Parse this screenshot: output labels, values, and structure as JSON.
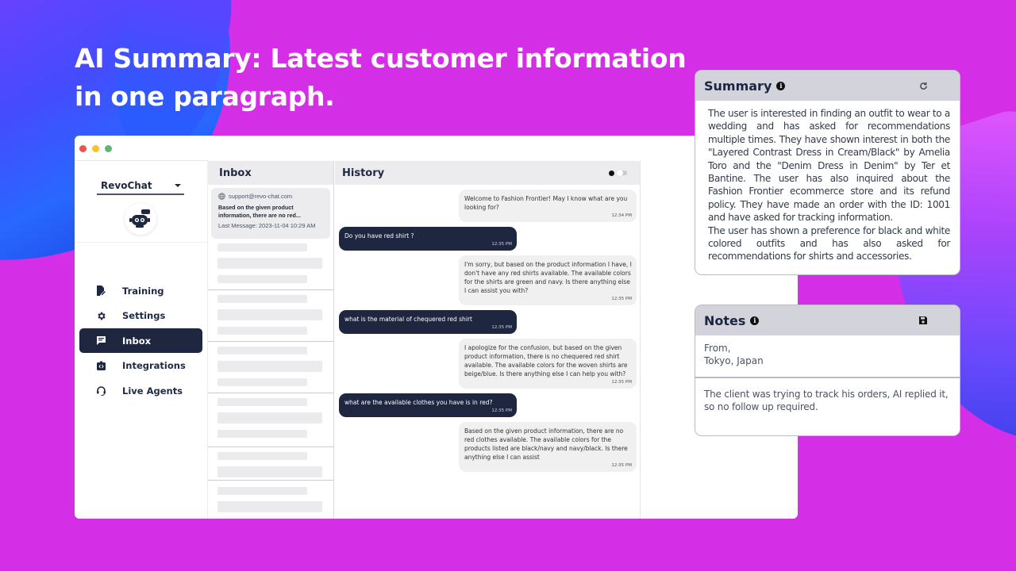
{
  "headline": {
    "line1": "AI Summary: Latest customer information",
    "line2": "in one paragraph."
  },
  "sidebar": {
    "brand": "RevoChat",
    "items": [
      {
        "label": "Training",
        "icon": "training-icon",
        "active": false
      },
      {
        "label": "Settings",
        "icon": "gear-icon",
        "active": false
      },
      {
        "label": "Inbox",
        "icon": "inbox-icon",
        "active": true
      },
      {
        "label": "Integrations",
        "icon": "integrations-icon",
        "active": false
      },
      {
        "label": "Live Agents",
        "icon": "headset-icon",
        "active": false
      }
    ]
  },
  "inbox": {
    "title": "Inbox",
    "card": {
      "email": "support@revo-chat.com",
      "preview": "Based on the given product information, there are no red...",
      "last_message": "Last Message: 2023-11-04 10:29 AM"
    }
  },
  "history": {
    "title": "History",
    "messages": [
      {
        "role": "bot",
        "text": "Welcome to Fashion Frontier! May I know what are you looking for?",
        "time": "12:34 PM"
      },
      {
        "role": "user",
        "text": "Do you have red shirt ?",
        "time": "12:35 PM"
      },
      {
        "role": "bot",
        "text": "I'm sorry, but based on the product information I have, I don't have any red shirts available. The available colors for the shirts are green and navy. Is there anything else I can assist you with?",
        "time": "12:35 PM"
      },
      {
        "role": "user",
        "text": "what is the material of chequered red shirt",
        "time": "12:35 PM"
      },
      {
        "role": "bot",
        "text": "I apologize for the confusion, but based on the given product information, there is no chequered red shirt available. The available colors for the woven shirts are beige/blue. Is there anything else I can help you with?",
        "time": "12:35 PM"
      },
      {
        "role": "user",
        "text": "what are the available clothes you have is in red?",
        "time": "12:35 PM"
      },
      {
        "role": "bot",
        "text": "Based on the given product information, there are no red clothes available. The available colors for the products listed are black/navy and navy/black. Is there anything else I can assist",
        "time": "12:35 PM"
      }
    ]
  },
  "summary": {
    "title": "Summary",
    "paragraph1": "The user is interested in finding an outfit to wear to a wedding and has asked for recommendations multiple times. They have shown interest in both the \"Layered Contrast Dress in Cream/Black\" by Amelia Toro and the \"Denim Dress in Denim\" by Ter et Bantine. The user has also inquired about the Fashion Frontier ecommerce store and its refund policy. They have made an order with the ID: 1001 and have asked for tracking information.",
    "paragraph2": "The user has shown a preference for black and white colored outfits and has also asked for recommendations for shirts and accessories."
  },
  "notes": {
    "title": "Notes",
    "from_line1": "From,",
    "from_line2": "Tokyo, Japan",
    "body": "The client was trying to track his orders, AI replied it, so no follow up required."
  },
  "colors": {
    "background": "#d42ee6",
    "nav_active": "#1e2640",
    "user_bubble": "#1e2640",
    "bot_bubble": "#f0f0f1",
    "panel_header": "#d2d3db"
  }
}
